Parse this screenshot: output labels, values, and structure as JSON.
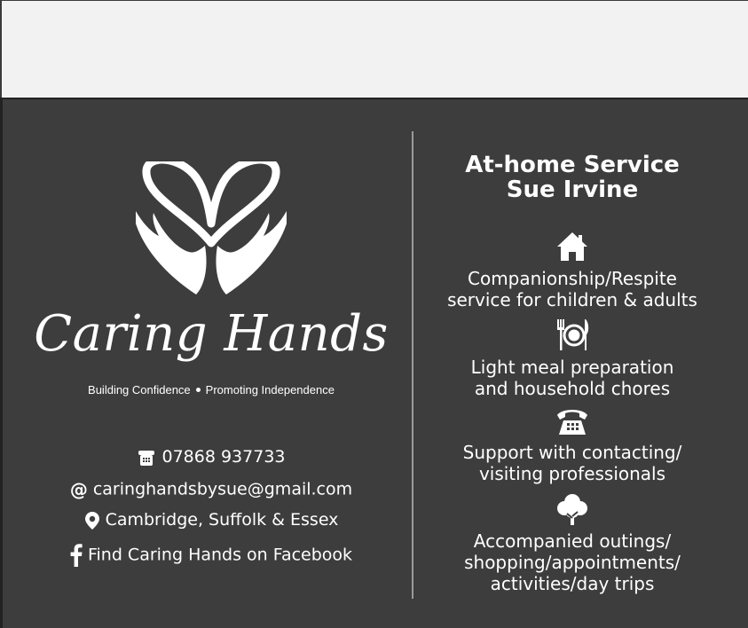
{
  "brand": {
    "name": "Caring Hands",
    "tagline_left": "Building Confidence",
    "tagline_right": "Promoting Independence"
  },
  "contact": {
    "phone": "07868 937733",
    "email": "caringhandsbysue@gmail.com",
    "location": "Cambridge, Suffolk & Essex",
    "facebook": "Find Caring Hands on Facebook"
  },
  "service": {
    "title_line1": "At-home Service",
    "title_line2": "Sue Irvine",
    "items": [
      {
        "icon": "house-icon",
        "line1": "Companionship/Respite",
        "line2": "service for children & adults"
      },
      {
        "icon": "plate-cutlery-icon",
        "line1": "Light meal preparation",
        "line2": "and household chores"
      },
      {
        "icon": "telephone-icon",
        "line1": "Support with contacting/",
        "line2": "visiting professionals"
      },
      {
        "icon": "tree-icon",
        "line1": "Accompanied outings/",
        "line2": "shopping/appointments/",
        "line3": "activities/day trips"
      }
    ]
  },
  "colors": {
    "card_background": "#3d3d3d",
    "text": "#ffffff",
    "divider": "#9a9a9a",
    "page_background": "#f2f2f2"
  }
}
